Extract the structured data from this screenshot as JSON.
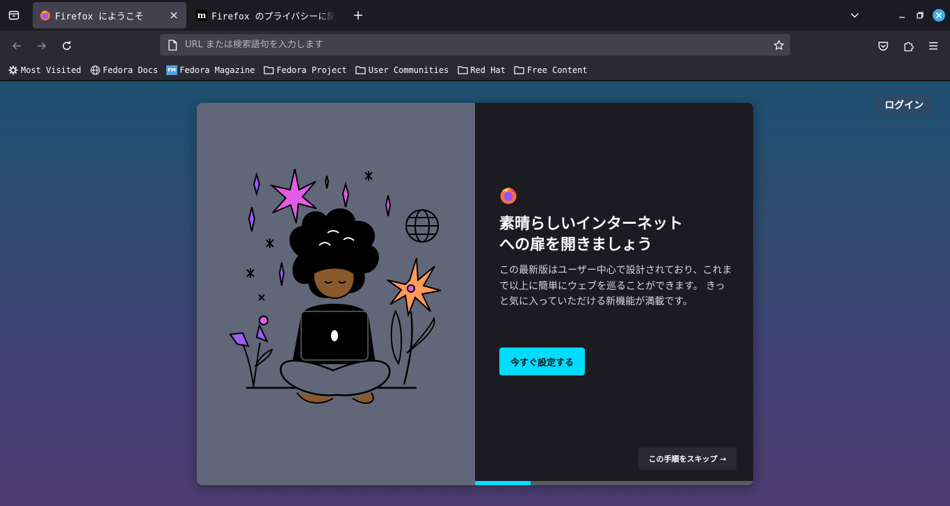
{
  "tabs": [
    {
      "title": "Firefox にようこそ",
      "active": true,
      "icon": "firefox-icon"
    },
    {
      "title": "Firefox のプライバシーに関する通知",
      "active": false,
      "icon": "mozilla-icon"
    }
  ],
  "urlbar": {
    "placeholder": "URL または検索語句を入力します"
  },
  "bookmarks": [
    {
      "label": "Most Visited",
      "icon": "gear-icon"
    },
    {
      "label": "Fedora Docs",
      "icon": "globe-icon"
    },
    {
      "label": "Fedora Magazine",
      "icon": "fedora-magazine-icon"
    },
    {
      "label": "Fedora Project",
      "icon": "folder-icon"
    },
    {
      "label": "User Communities",
      "icon": "folder-icon"
    },
    {
      "label": "Red Hat",
      "icon": "folder-icon"
    },
    {
      "label": "Free Content",
      "icon": "folder-icon"
    }
  ],
  "page": {
    "login_label": "ログイン",
    "headline_line1": "素晴らしいインターネット",
    "headline_line2": "への扉を開きましょう",
    "subtitle": "この最新版はユーザー中心で設計されており、これまで以上に簡単にウェブを巡ることができます。 きっと気に入っていただける新機能が満載です。",
    "primary_button": "今すぐ設定する",
    "skip_button": "この手順をスキップ →",
    "progress_fraction": 0.2
  },
  "colors": {
    "accent": "#00ddff",
    "chrome_dark": "#1c1b22",
    "toolbar": "#2b2a33",
    "card_left": "#616778"
  }
}
